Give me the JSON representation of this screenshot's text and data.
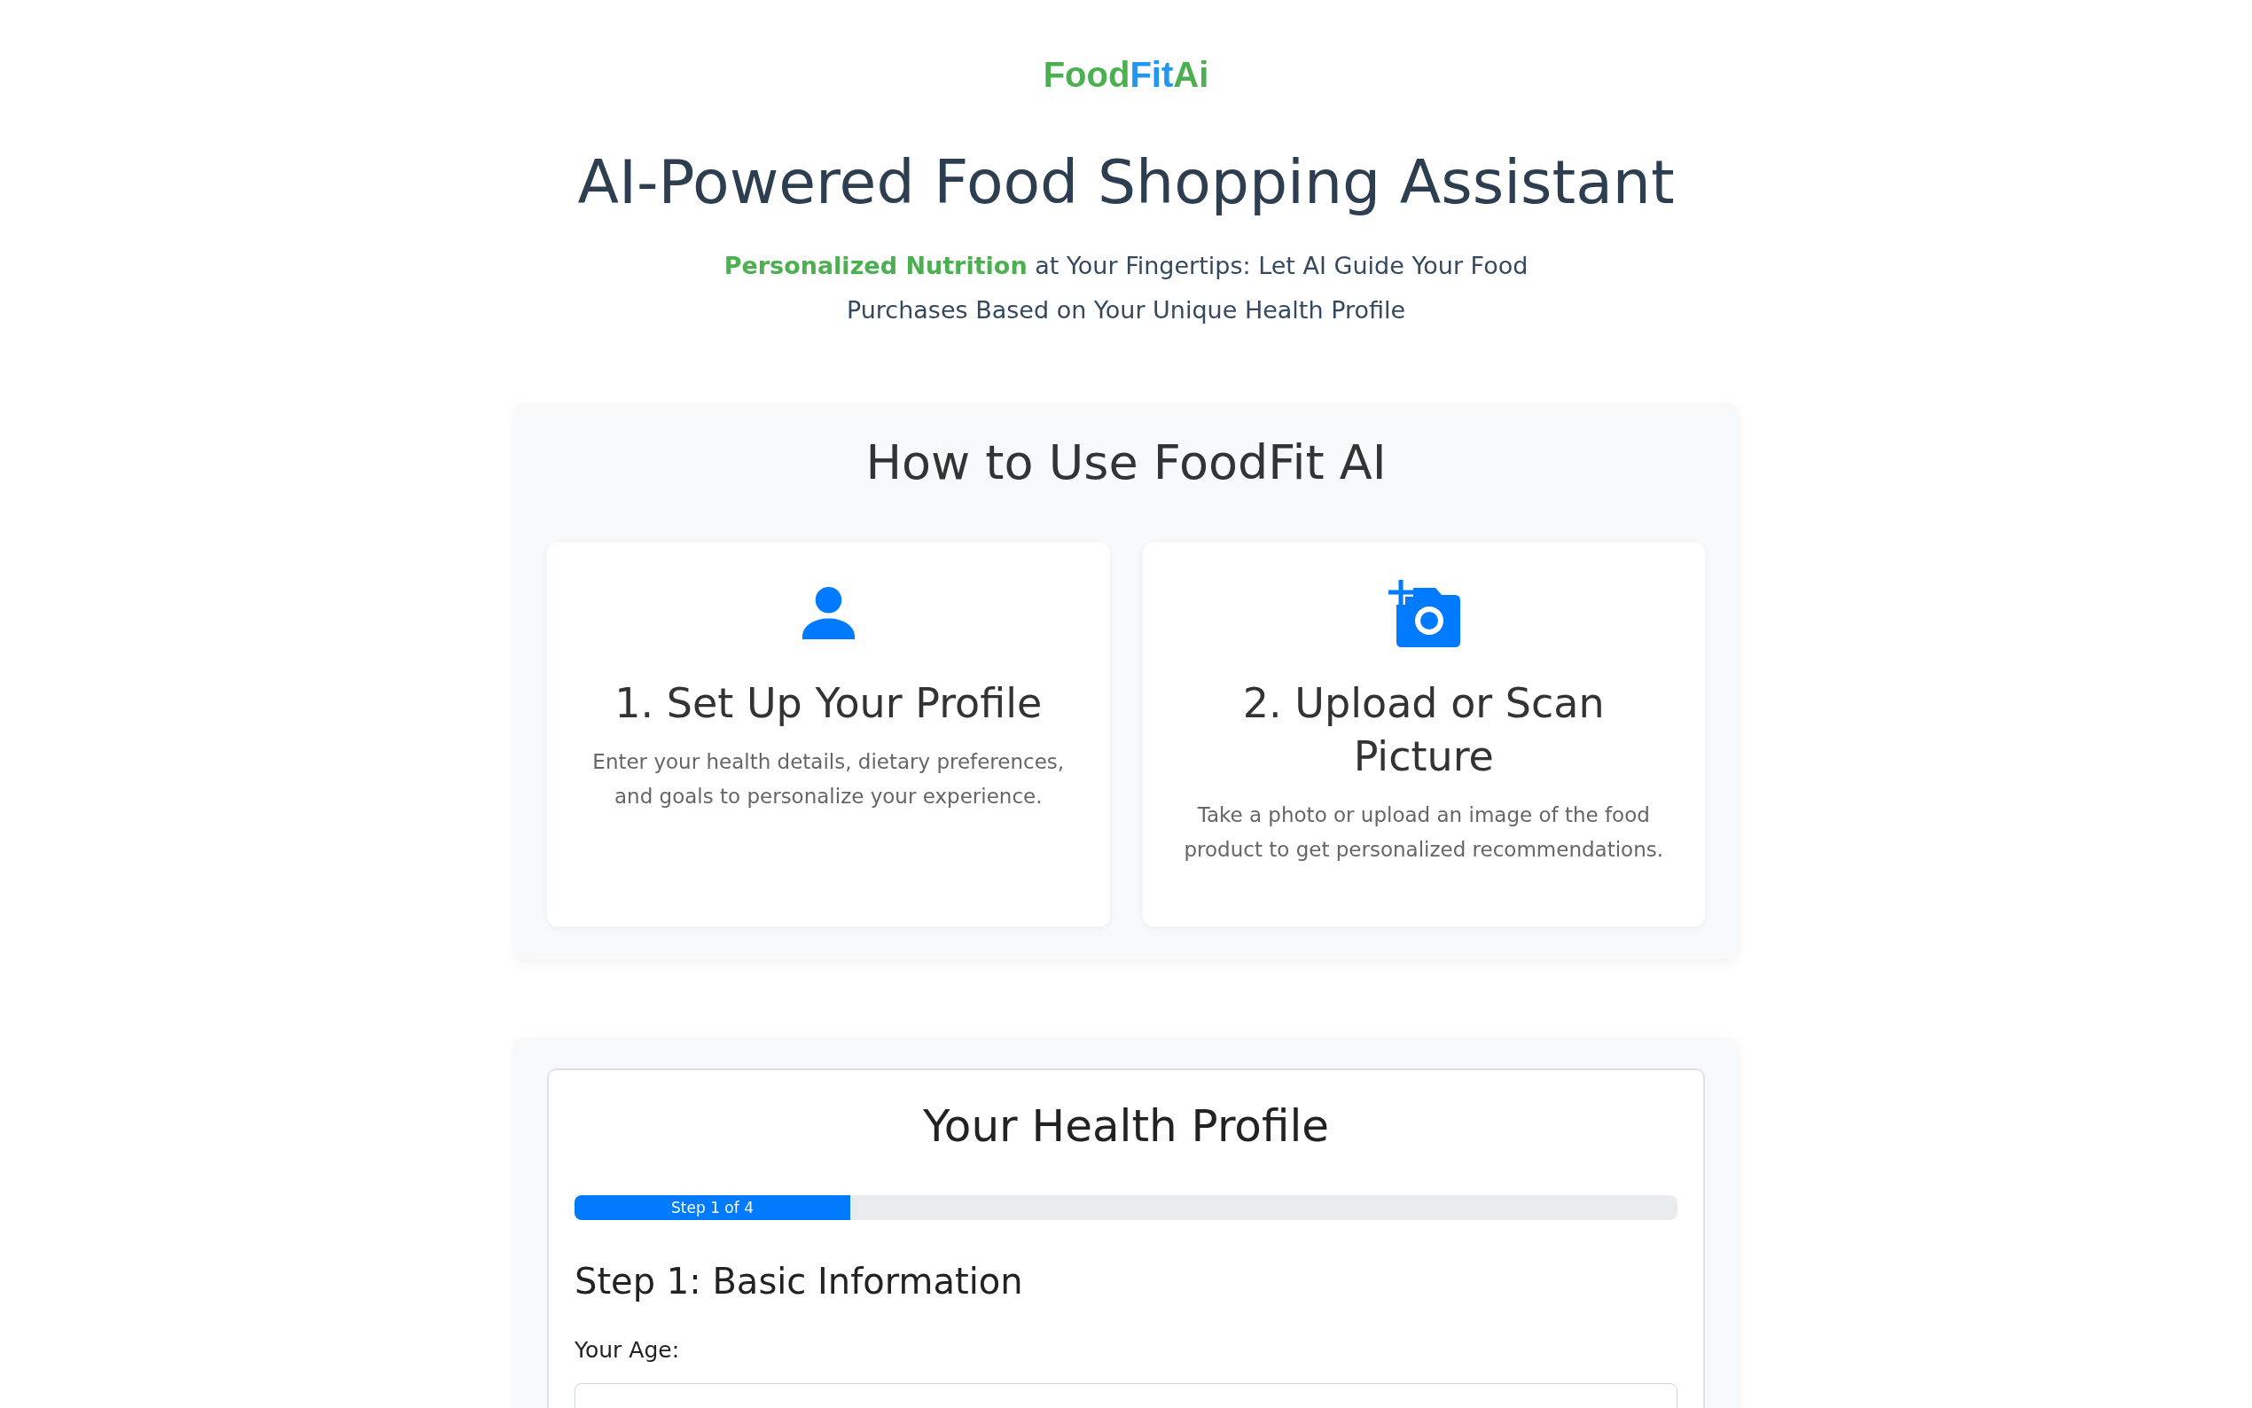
{
  "logo": {
    "parts": [
      {
        "text": "Food",
        "color": "#4caf50"
      },
      {
        "text": "Fit",
        "color": "#2196f3"
      },
      {
        "text": "Ai",
        "color": "#4caf50"
      }
    ]
  },
  "title": "AI-Powered Food Shopping Assistant",
  "subtitle": "**Personalized Nutrition** at Your Fingertips: Let AI Guide Your Food Purchases Based on Your Unique Health Profile",
  "how_to": {
    "heading": "How to Use FoodFit AI",
    "steps": [
      {
        "kind": "profile",
        "title": "1. Set Up Your Profile",
        "description": "Enter your health details, dietary preferences, and goals to personalize your experience."
      },
      {
        "kind": "upload",
        "title": "2. Upload or Scan Picture",
        "description": "Take a photo or upload an image of the food product to get personalized recommendations."
      }
    ]
  },
  "health_profile": {
    "heading": "Your Health Profile",
    "progress": {
      "label": "Step 1 of 4",
      "level": 0.25
    },
    "step_heading": "Step 1: Basic Information",
    "fields": [
      {
        "label": "Your Age:"
      }
    ]
  }
}
